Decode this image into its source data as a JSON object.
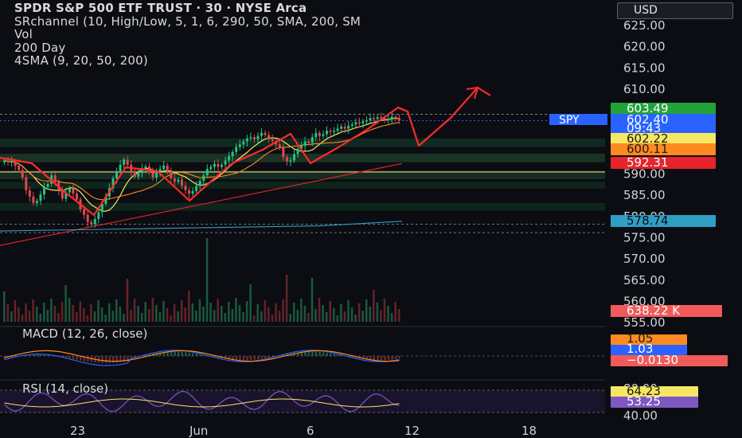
{
  "symbol": "SPY",
  "legend": {
    "title": "SPDR S&P 500 ETF TRUST · 30 · NYSE Arca",
    "line2": "SRchannel (10, High/Low, 5, 1, 6, 290, 50, SMA, 200, SM",
    "line3": "Vol",
    "line4": "200 Day",
    "line5": "4SMA (9, 20, 50, 200)"
  },
  "currency_button": "USD",
  "price_axis": {
    "ticks": [
      "625.00",
      "620.00",
      "615.00",
      "610.00",
      "575.00",
      "570.00",
      "565.00",
      "560.00",
      "555.00",
      "590.00",
      "585.00",
      "580.00"
    ],
    "tick_values": [
      625,
      620,
      615,
      610,
      575,
      570,
      565,
      560,
      555,
      590,
      585,
      580
    ]
  },
  "price_labels": {
    "last": "603.49",
    "spy": "602.40",
    "countdown": "09:43",
    "sma_a": "602.22",
    "sma_b": "600.11",
    "sma_c": "592.31",
    "sma_d": "578.74",
    "volume": "638.22 K"
  },
  "macd": {
    "label": "MACD (12, 26, close)",
    "values": [
      "1.05",
      "1.03",
      "−0.0130"
    ]
  },
  "rsi": {
    "label": "RSI (14, close)",
    "ticks": [
      "80.00",
      "40.00"
    ],
    "values": [
      "64.23",
      "53.25"
    ]
  },
  "time_axis": [
    "23",
    "Jun",
    "6",
    "12",
    "18"
  ],
  "colors": {
    "background": "#0b0d12",
    "up": "#26c281",
    "down": "#e0484f",
    "last_price": "#22a33a",
    "spy_badge": "#2962ff",
    "yellow": "#f5e663",
    "orange": "#ff8a1f",
    "red": "#e8232b",
    "teal": "#2f9ec4",
    "macd_neg": "#f25a5a",
    "rsi_purple": "#7e57c2",
    "drawing": "#ff2a2a"
  },
  "chart_data": {
    "type": "candlestick",
    "symbol": "SPY",
    "interval": "30",
    "last_price": 603.49,
    "ylim": [
      553,
      628
    ],
    "sma_values": [
      602.22,
      600.11,
      592.31,
      578.74
    ],
    "closes": [
      593.0,
      592.6,
      592.8,
      591.8,
      590.8,
      589.0,
      586.0,
      584.5,
      583.0,
      583.5,
      585.0,
      586.8,
      587.5,
      589.5,
      588.0,
      586.0,
      584.0,
      585.5,
      586.5,
      585.2,
      583.8,
      581.5,
      580.2,
      578.5,
      578.0,
      579.2,
      580.8,
      582.8,
      584.5,
      586.5,
      588.8,
      590.5,
      592.0,
      593.2,
      592.0,
      590.5,
      589.2,
      590.0,
      591.2,
      591.6,
      590.2,
      589.0,
      590.5,
      591.0,
      591.8,
      590.5,
      588.8,
      588.0,
      588.5,
      587.0,
      586.0,
      585.2,
      585.8,
      587.0,
      588.2,
      589.5,
      591.0,
      591.5,
      592.2,
      591.5,
      592.0,
      593.0,
      594.0,
      595.0,
      596.2,
      596.8,
      597.5,
      598.2,
      598.5,
      598.0,
      598.8,
      599.5,
      599.0,
      598.0,
      597.6,
      596.8,
      596.0,
      593.8,
      592.8,
      593.0,
      594.5,
      595.8,
      596.5,
      597.5,
      597.2,
      598.5,
      599.5,
      598.8,
      599.2,
      600.0,
      599.8,
      600.0,
      600.5,
      601.0,
      600.5,
      601.2,
      601.5,
      602.0,
      601.8,
      602.2,
      602.5,
      603.0,
      602.8,
      603.2,
      603.0,
      602.6,
      602.9,
      603.3,
      603.0,
      602.4
    ]
  }
}
